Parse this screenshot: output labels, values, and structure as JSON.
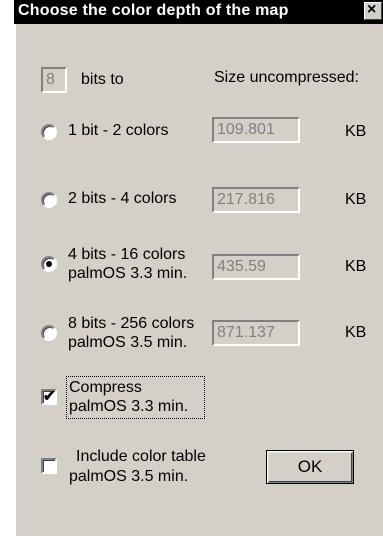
{
  "window": {
    "title": "Choose the color depth of the map",
    "close_glyph": "×"
  },
  "bits_field": {
    "value": "8",
    "label": "bits to"
  },
  "size_header": "Size uncompressed:",
  "unit": "KB",
  "options": [
    {
      "label_line1": "1 bit - 2 colors",
      "label_line2": "",
      "size": "109.801",
      "selected": false
    },
    {
      "label_line1": "2 bits - 4 colors",
      "label_line2": "",
      "size": "217.816",
      "selected": false
    },
    {
      "label_line1": "4 bits - 16 colors",
      "label_line2": "palmOS 3.3 min.",
      "size": "435.59",
      "selected": true
    },
    {
      "label_line1": "8 bits - 256 colors",
      "label_line2": "palmOS 3.5 min.",
      "size": "871.137",
      "selected": false
    }
  ],
  "compress": {
    "label_line1": "Compress",
    "label_line2": "palmOS 3.3 min.",
    "checked": true
  },
  "color_table": {
    "label_line1": "Include color table",
    "label_line2": "palmOS 3.5 min.",
    "checked": false
  },
  "ok_label": "OK"
}
